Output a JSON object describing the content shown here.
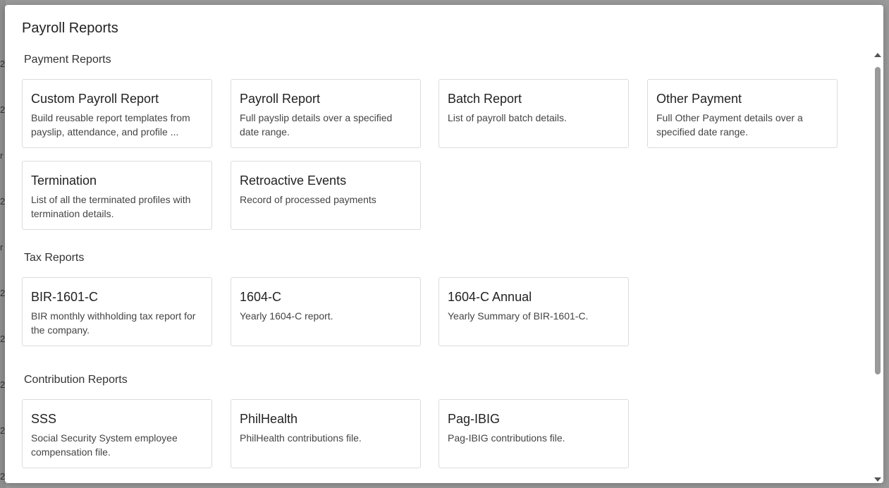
{
  "dialog": {
    "title": "Payroll Reports"
  },
  "sections": {
    "payment": {
      "title": "Payment Reports",
      "cards": [
        {
          "title": "Custom Payroll Report",
          "description": "Build reusable report templates from payslip, attendance, and profile ..."
        },
        {
          "title": "Payroll Report",
          "description": "Full payslip details over a specified date range."
        },
        {
          "title": "Batch Report",
          "description": "List of payroll batch details."
        },
        {
          "title": "Other Payment",
          "description": "Full Other Payment details over a specified date range."
        },
        {
          "title": "Termination",
          "description": "List of all the terminated profiles with termination details."
        },
        {
          "title": "Retroactive Events",
          "description": "Record of processed payments"
        }
      ]
    },
    "tax": {
      "title": "Tax Reports",
      "cards": [
        {
          "title": "BIR-1601-C",
          "description": "BIR monthly withholding tax report for the company."
        },
        {
          "title": "1604-C",
          "description": "Yearly 1604-C report."
        },
        {
          "title": "1604-C Annual",
          "description": "Yearly Summary of BIR-1601-C."
        }
      ]
    },
    "contribution": {
      "title": "Contribution Reports",
      "cards": [
        {
          "title": "SSS",
          "description": "Social Security System employee compensation file."
        },
        {
          "title": "PhilHealth",
          "description": "PhilHealth contributions file."
        },
        {
          "title": "Pag-IBIG",
          "description": "Pag-IBIG contributions file."
        }
      ]
    }
  },
  "background": {
    "row_chars": [
      "2",
      "2",
      "r",
      "2",
      "r",
      "2",
      "2",
      "2",
      "2",
      "2"
    ]
  }
}
